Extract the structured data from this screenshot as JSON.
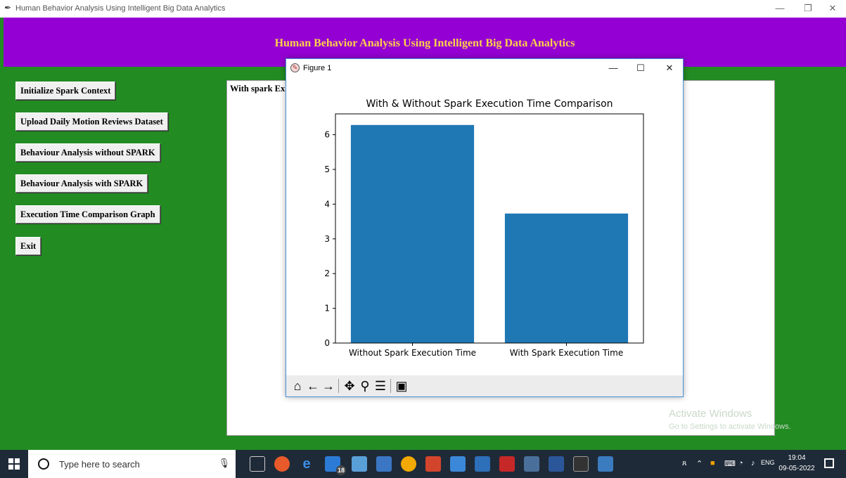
{
  "window": {
    "title": "Human Behavior Analysis Using Intelligent Big Data Analytics",
    "minimize": "—",
    "maximize": "❐",
    "close": "✕"
  },
  "header": {
    "title": "Human Behavior Analysis Using Intelligent Big Data Analytics",
    "title_color": "#FFD24A",
    "background": "#9400D3"
  },
  "sidebar": {
    "buttons": [
      {
        "label": "Initialize Spark Context"
      },
      {
        "label": "Upload Daily Motion Reviews Dataset"
      },
      {
        "label": "Behaviour Analysis without SPARK"
      },
      {
        "label": "Behaviour Analysis with SPARK"
      },
      {
        "label": "Execution Time Comparison Graph"
      },
      {
        "label": "Exit"
      }
    ]
  },
  "output": {
    "text": "With spark Ex"
  },
  "watermark": {
    "line1": "Activate Windows",
    "line2": "Go to Settings to activate Windows."
  },
  "figure": {
    "title": "Figure 1",
    "minimize": "—",
    "maximize": "☐",
    "close": "✕",
    "toolbar": [
      "home-icon",
      "back-arrow-icon",
      "forward-arrow-icon",
      "pan-icon",
      "zoom-icon",
      "configure-subplots-icon",
      "save-icon"
    ]
  },
  "chart_data": {
    "type": "bar",
    "title": "With & Without Spark Execution Time Comparison",
    "categories": [
      "Without Spark Execution Time",
      "With Spark Execution Time"
    ],
    "values": [
      6.28,
      3.73
    ],
    "xlabel": "",
    "ylabel": "",
    "ylim": [
      0,
      6.6
    ],
    "yticks": [
      0,
      1,
      2,
      3,
      4,
      5,
      6
    ],
    "bar_color": "#1f77b4",
    "grid": false
  },
  "taskbar": {
    "search_placeholder": "Type here to search",
    "badge_count": "18",
    "time": "19:04",
    "date": "09-05-2022",
    "lang": "ENG"
  }
}
